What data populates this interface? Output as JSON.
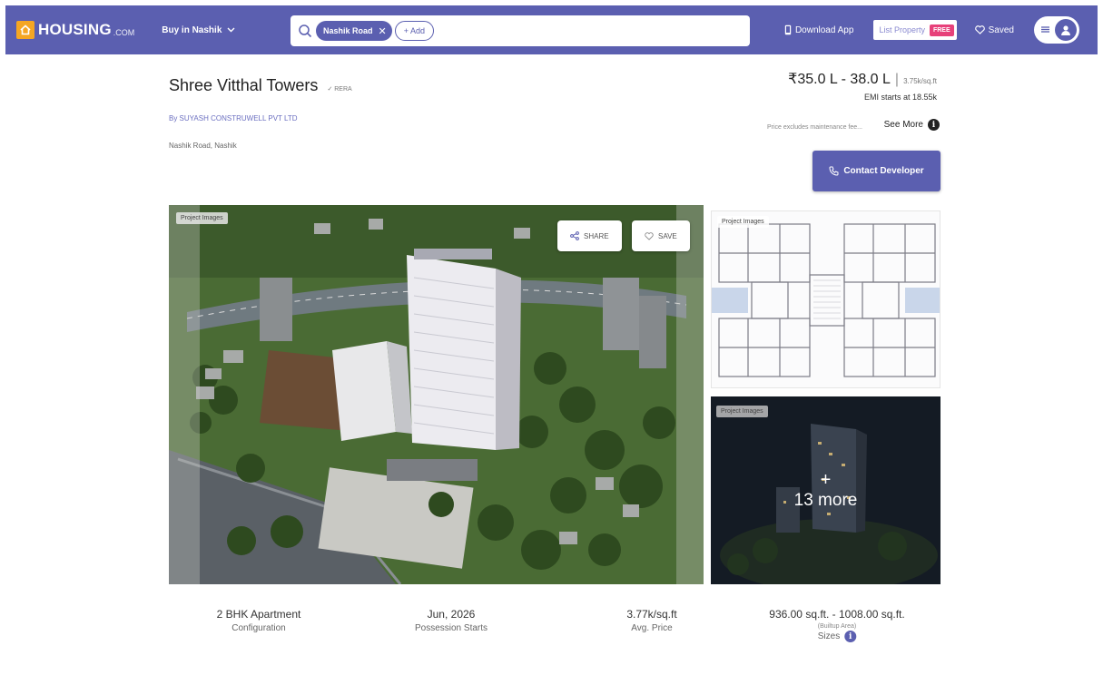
{
  "navbar": {
    "logo_text": "HOUSING",
    "logo_suffix": ".COM",
    "city_selector": "Buy in Nashik",
    "search_chip": "Nashik Road",
    "add_button": "+ Add",
    "download_app": "Download App",
    "list_property": "List Property",
    "free_badge": "FREE",
    "saved": "Saved",
    "brand_color": "#5b5fb0",
    "badge_color": "#e7417a"
  },
  "project": {
    "title": "Shree Vitthal Towers",
    "rera": "RERA",
    "developer": "By SUYASH CONSTRUWELL PVT LTD",
    "locality": "Nashik Road, Nashik"
  },
  "pricing": {
    "range": "₹35.0 L - 38.0 L",
    "per_sqft": "3.75k/sq.ft",
    "emi": "EMI starts at 18.55k",
    "note": "Price excludes maintenance fee...",
    "see_more": "See More",
    "contact_button": "Contact Developer"
  },
  "gallery": {
    "main_label": "Project Images",
    "share_label": "SHARE",
    "save_label": "SAVE",
    "floorplan_label": "Project Images",
    "more_tile_label": "Project Images",
    "more_plus": "+",
    "more_count": "13 more"
  },
  "facts": {
    "configuration": {
      "value": "2 BHK Apartment",
      "label": "Configuration"
    },
    "possession": {
      "value": "Jun, 2026",
      "label": "Possession Starts"
    },
    "avg_price": {
      "value": "3.77k/sq.ft",
      "label": "Avg. Price"
    },
    "sizes": {
      "value": "936.00 sq.ft. - 1008.00 sq.ft.",
      "sub": "(Builtup Area)",
      "label": "Sizes"
    }
  }
}
